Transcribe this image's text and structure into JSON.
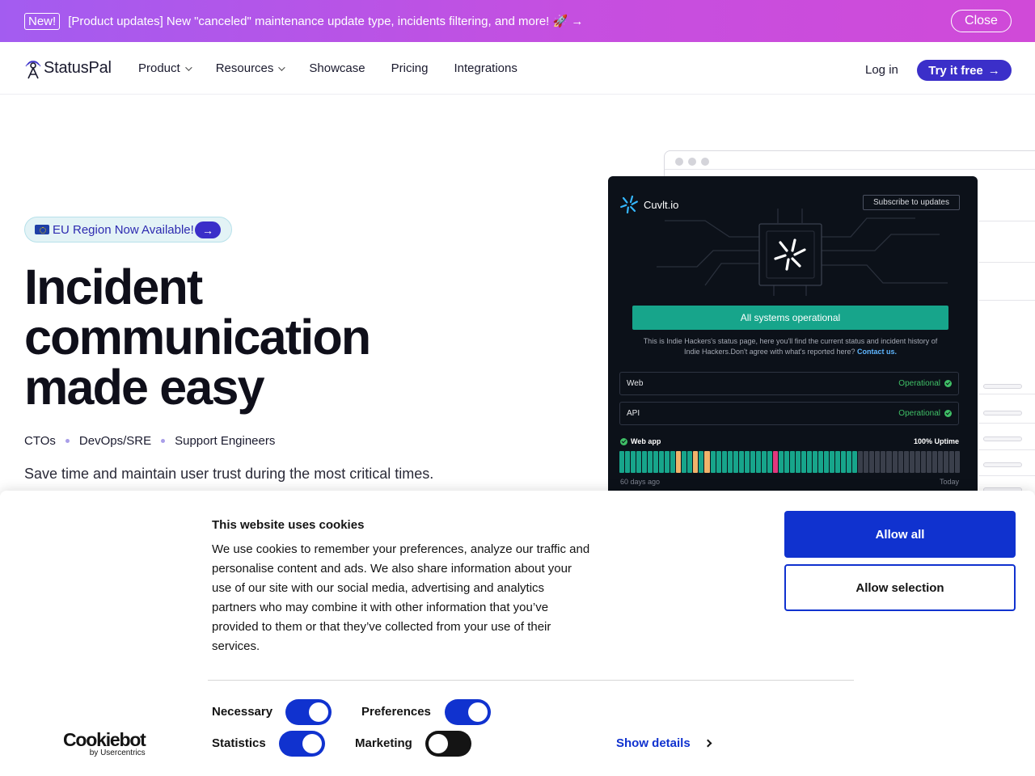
{
  "announcement": {
    "badge": "New!",
    "message": "[Product updates] New \"canceled\" maintenance update type, incidents filtering, and more! 🚀 →",
    "close_label": "Close"
  },
  "nav": {
    "logo_text": "StatusPal",
    "links": [
      {
        "label": "Product",
        "has_dropdown": true
      },
      {
        "label": "Resources",
        "has_dropdown": true
      },
      {
        "label": "Showcase",
        "has_dropdown": false
      },
      {
        "label": "Pricing",
        "has_dropdown": false
      },
      {
        "label": "Integrations",
        "has_dropdown": false
      }
    ],
    "login_label": "Log in",
    "cta_label": "Try it free",
    "cta_arrow": "→"
  },
  "hero": {
    "eu_pill": "EU Region Now Available!",
    "eu_arrow": "→",
    "title_line1": "Incident",
    "title_line2": "communication",
    "title_line3": "made easy",
    "roles": [
      "CTOs",
      "DevOps/SRE",
      "Support Engineers"
    ],
    "tagline": "Save time and maintain user trust during the most critical times."
  },
  "status_card": {
    "brand": "Cuvlt.io",
    "subscribe_label": "Subscribe to updates",
    "banner": "All systems operational",
    "description": "This is Indie Hackers's status page, here you'll find the current status and incident history of Indie Hackers.Don't agree with what's reported here?",
    "contact_link": "Contact us.",
    "services": [
      {
        "name": "Web",
        "status": "Operational"
      },
      {
        "name": "API",
        "status": "Operational"
      }
    ],
    "uptime_service": "Web app",
    "uptime_value": "100% Uptime",
    "range_start": "60 days ago",
    "range_end": "Today",
    "uptime_days": [
      "up",
      "up",
      "up",
      "up",
      "up",
      "up",
      "up",
      "up",
      "up",
      "up",
      "warn",
      "up",
      "up",
      "warn",
      "up",
      "warn",
      "up",
      "up",
      "up",
      "up",
      "up",
      "up",
      "up",
      "up",
      "up",
      "up",
      "up",
      "down",
      "up",
      "up",
      "up",
      "up",
      "up",
      "up",
      "up",
      "up",
      "up",
      "up",
      "up",
      "up",
      "up",
      "up",
      "none",
      "none",
      "none",
      "none",
      "none",
      "none",
      "none",
      "none",
      "none",
      "none",
      "none",
      "none",
      "none",
      "none",
      "none",
      "none",
      "none",
      "none"
    ],
    "colors": {
      "up": "#17a58b",
      "warn": "#f0b36b",
      "down": "#e2377e",
      "none": "#3a3f4b"
    }
  },
  "cookie": {
    "title": "This website uses cookies",
    "body": "We use cookies to remember your preferences, analyze our traffic and personalise content and ads. We also share information about your use of our site with our social media, advertising and analytics partners who may combine it with other information that you’ve provided to them or that they’ve collected from your use of their services.",
    "allow_all": "Allow all",
    "allow_selection": "Allow selection",
    "toggles": {
      "necessary": {
        "label": "Necessary",
        "on": true
      },
      "preferences": {
        "label": "Preferences",
        "on": true
      },
      "statistics": {
        "label": "Statistics",
        "on": true
      },
      "marketing": {
        "label": "Marketing",
        "on": false
      }
    },
    "logo_main": "Cookiebot",
    "logo_by": "by Usercentrics",
    "show_details": "Show details"
  },
  "colors": {
    "accent": "#3b2fc9",
    "cookie_blue": "#1032cf",
    "operational_green": "#3fbf66"
  }
}
